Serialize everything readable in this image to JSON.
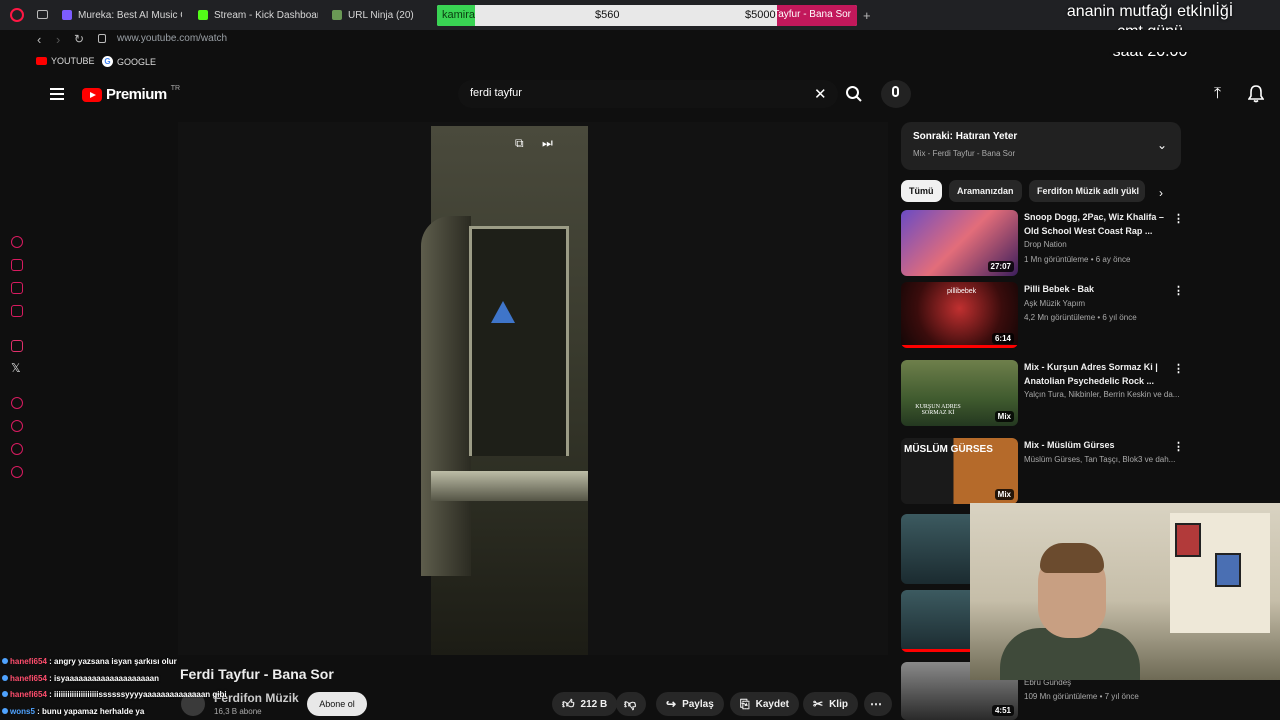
{
  "browser": {
    "tabs": [
      {
        "label": "Mureka: Best AI Music Ge",
        "color": "#7c5cff"
      },
      {
        "label": "Stream - Kick Dashboard",
        "color": "#53fc18"
      },
      {
        "label": "URL Ninja (20)",
        "color": "#6a9955"
      }
    ],
    "active_tab_label": "Tayfur - Bana Sor",
    "url": "www.youtube.com/watch",
    "bookmarks": [
      "YOUTUBE",
      "GOOGLE"
    ]
  },
  "stream_overlay": {
    "goal_label": "kamira",
    "goal_current": "$560",
    "goal_target": "$5000",
    "note_line1": "ananin mutfağı etkİnlİğİ",
    "note_line2": "cmt günü",
    "note_line3": "saat 20.00"
  },
  "youtube": {
    "logo_text": "Premium",
    "logo_region": "TR",
    "search_value": "ferdi tayfur"
  },
  "video": {
    "title": "Ferdi Tayfur - Bana Sor",
    "channel": "Ferdifon Müzik",
    "subscribers": "16,3 B abone",
    "subscribe_label": "Abone ol",
    "likes": "212 B",
    "share_label": "Paylaş",
    "save_label": "Kaydet",
    "clip_label": "Klip"
  },
  "up_next": {
    "title": "Sonraki: Hatıran Yeter",
    "subtitle": "Mix - Ferdi Tayfur - Bana Sor"
  },
  "chips": [
    "Tümü",
    "Aramanızdan",
    "Ferdifon Müzik adlı yükl"
  ],
  "recommendations": [
    {
      "title": "Snoop Dogg, 2Pac, Wiz Khalifa – Old School West Coast Rap ...",
      "channel": "Drop Nation",
      "meta": "1 Mn görüntüleme • 6 ay önce",
      "duration": "27:07"
    },
    {
      "title": "Pilli Bebek - Bak",
      "channel": "Aşk Müzik Yapım",
      "meta": "4,2 Mn görüntüleme • 6 yıl önce",
      "duration": "6:14",
      "thumb_text": "pillibebek"
    },
    {
      "title": "Mix - Kurşun Adres Sormaz Ki | Anatolian Psychedelic Rock ...",
      "channel": "Yalçın Tura, Nikbinler, Berrin Keskin ve da...",
      "meta": "",
      "duration": "Mix",
      "thumb_text": "KURŞUN ADRES SORMAZ Kİ"
    },
    {
      "title": "Mix - Müslüm Gürses",
      "channel": "Müslüm Gürses, Tan Taşçı, Blok3 ve dah...",
      "meta": "",
      "duration": "Mix",
      "thumb_text": "MÜSLÜM GÜRSES"
    },
    {
      "title": "",
      "channel": "",
      "meta": "",
      "duration": ""
    },
    {
      "title": "",
      "channel": "Ebru Gündeş",
      "meta": "109 Mn görüntüleme • 7 yıl önce",
      "duration": "4:51"
    }
  ],
  "chat": [
    {
      "user": "hanefi654",
      "msg": ": angry yazsana isyan şarkısı olur",
      "color": "#ff4d6d"
    },
    {
      "user": "hanefi654",
      "msg": ": isyaaaaaaaaaaaaaaaaaaaan",
      "color": "#ff4d6d"
    },
    {
      "user": "hanefi654",
      "msg": ": iiiiiiiiiiiiiiiiiiiissssssyyyyaaaaaaaaaaaaaan gibi",
      "color": "#ff4d6d"
    },
    {
      "user": "wons5",
      "msg": ": bunu yapamaz herhalde ya",
      "color": "#4fa3ff"
    }
  ]
}
